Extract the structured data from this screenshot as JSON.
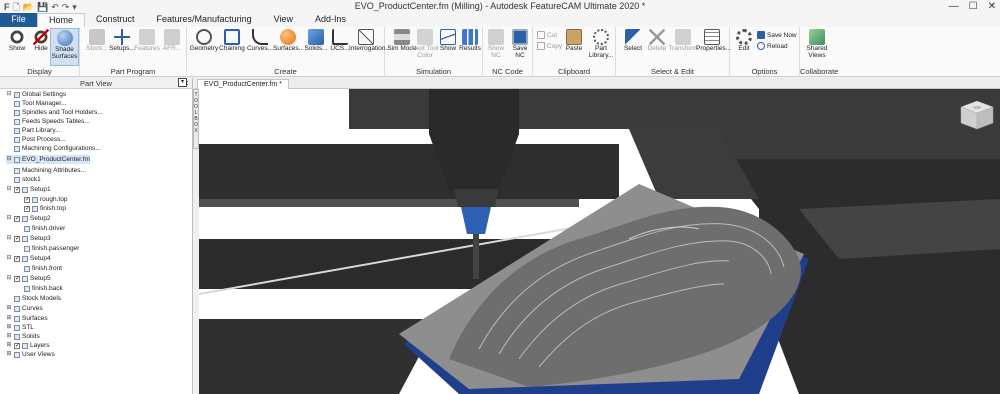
{
  "window": {
    "title": "EVO_ProductCenter.fm (Milling) - Autodesk FeatureCAM Ultimate 2020 *",
    "controls": [
      "—",
      "☐",
      "✕"
    ]
  },
  "quick_access": [
    "F",
    "🗋",
    "📂",
    "💾",
    "↶",
    "↷",
    "▾"
  ],
  "tabs": [
    "File",
    "Home",
    "Construct",
    "Features/Manufacturing",
    "View",
    "Add-Ins"
  ],
  "active_tab": "Home",
  "ribbon": {
    "display": {
      "label": "Display",
      "buttons": [
        "Show",
        "Hide",
        "Shade Surfaces"
      ]
    },
    "part_program": {
      "label": "Part Program",
      "buttons": [
        "Stock...",
        "Setups...",
        "Features",
        "AFR..."
      ]
    },
    "create": {
      "label": "Create",
      "buttons": [
        "Geometry",
        "Chaining",
        "Curves...",
        "Surfaces...",
        "Solids...",
        "UCS...",
        "Interrogation..."
      ]
    },
    "simulation": {
      "label": "Simulation",
      "buttons": [
        "Sim Mode",
        "Next Tool Color",
        "Show",
        "Results"
      ]
    },
    "nc_code": {
      "label": "NC Code",
      "buttons": [
        "Show NC",
        "Save NC"
      ]
    },
    "clipboard": {
      "label": "Clipboard",
      "small": [
        "Cut",
        "Copy"
      ],
      "buttons": [
        "Paste",
        "Part Library..."
      ]
    },
    "select_edit": {
      "label": "Select & Edit",
      "buttons": [
        "Select",
        "Delete",
        "Transform",
        "Properties..."
      ]
    },
    "options": {
      "label": "Options",
      "buttons": [
        "Edit"
      ],
      "small": [
        "Save Now",
        "Reload"
      ]
    },
    "collaborate": {
      "label": "Collaborate",
      "buttons": [
        "Shared Views"
      ]
    }
  },
  "part_view": {
    "title": "Part View",
    "close": "✕",
    "items": [
      "Global Settings",
      "Tool Manager...",
      "Spindles and Tool Holders...",
      "Feeds  Speeds Tables...",
      "Part Library...",
      "Post Process...",
      "Machining Configurations...",
      "EVO_ProductCenter.fm",
      "Machining Attributes...",
      "stock1",
      "Setup1",
      "rough.top",
      "finish.top",
      "Setup2",
      "finish.driver",
      "Setup3",
      "finish.passenger",
      "Setup4",
      "finish.front",
      "Setup5",
      "finish.back",
      "Stock Models",
      "Curves",
      "Surfaces",
      "STL",
      "Solids",
      "Layers",
      "User Views"
    ]
  },
  "toolbox_label": "TOOLBOX",
  "doc_tab": "EVO_ProductCenter.fm *",
  "viewcube_label": "TOP",
  "colors": {
    "accent": "#1f5a99",
    "tool_blue": "#2d5fb3",
    "fixture_blue": "#2f56b5"
  }
}
